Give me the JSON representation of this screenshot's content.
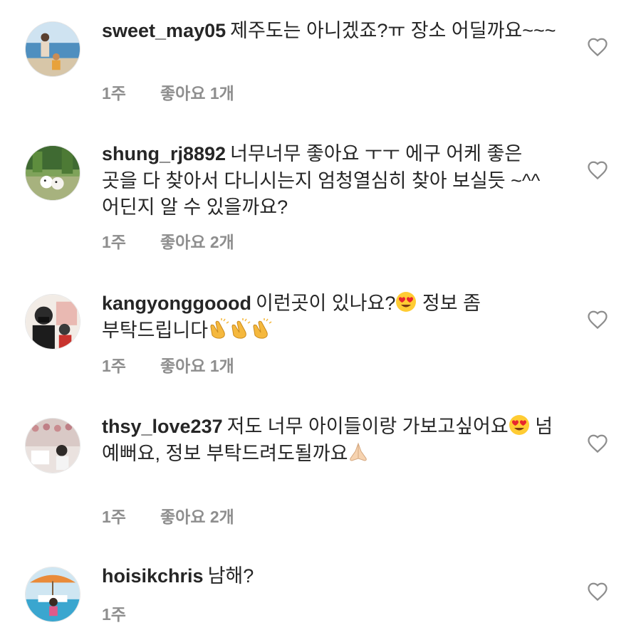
{
  "comments": [
    {
      "username": "sweet_may05",
      "text_parts": [
        "제주도는 아니겠죠?ㅠ 장소 어딜까요~~~"
      ],
      "time": "1주",
      "likes": "좋아요 1개"
    },
    {
      "username": "shung_rj8892",
      "text_parts": [
        "너무너무 좋아요 ㅜㅜ 에구 어케 좋은 곳을 다 찾아서 다니시는지 엄청열심히 찾아 보실듯 ~^^ 어딘지 알 수 있을까요?"
      ],
      "time": "1주",
      "likes": "좋아요 2개"
    },
    {
      "username": "kangyonggoood",
      "text_parts": [
        "이런곳이 있나요?",
        "정보 좀 부탁드립니다"
      ],
      "time": "1주",
      "likes": "좋아요 1개"
    },
    {
      "username": "thsy_love237",
      "text_parts": [
        "저도 너무 아이들이랑 가보고싶어요",
        "넘 예뻐요, 정보 부탁드려도될까요"
      ],
      "time": "1주",
      "likes": "좋아요 2개"
    },
    {
      "username": "hoisikchris",
      "text_parts": [
        "남해?"
      ],
      "time": "1주",
      "likes": ""
    }
  ],
  "icons": {
    "like": "heart-outline-icon",
    "emoji_heart_eyes": "heart-eyes-emoji",
    "emoji_clap": "clapping-hands-emoji",
    "emoji_pray": "folded-hands-emoji"
  },
  "colors": {
    "text": "#262626",
    "meta": "#8e8e8e",
    "heart": "#8e8e8e"
  }
}
